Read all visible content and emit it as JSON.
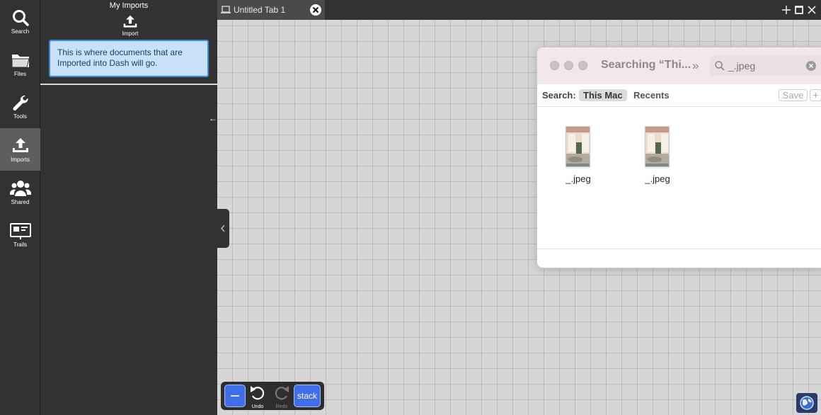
{
  "rail": {
    "items": [
      {
        "label": "Search",
        "icon": "search-icon"
      },
      {
        "label": "Files",
        "icon": "folder-icon"
      },
      {
        "label": "Tools",
        "icon": "wrench-icon"
      },
      {
        "label": "Imports",
        "icon": "upload-icon",
        "active": true
      },
      {
        "label": "Shared",
        "icon": "users-icon"
      },
      {
        "label": "Trails",
        "icon": "presentation-icon"
      }
    ]
  },
  "panel": {
    "title": "My Imports",
    "import_label": "Import",
    "info_text": "This is where documents that are Imported into Dash will go."
  },
  "tabs": {
    "active_title": "Untitled Tab 1"
  },
  "finder": {
    "title": "Searching “Thi...",
    "search_value": "_.jpeg",
    "scope_label": "Search:",
    "scope_this_mac": "This Mac",
    "scope_recents": "Recents",
    "save_label": "Save",
    "plus_label": "+",
    "files": [
      {
        "name": "_.jpeg"
      },
      {
        "name": "_.jpeg"
      }
    ]
  },
  "toolbar": {
    "undo_label": "Undo",
    "redo_label": "Redo",
    "stack_label": "stack"
  },
  "colors": {
    "accent_blue": "#3f6ee8",
    "dark_bg": "#323232",
    "info_box_bg": "#c8e1f8"
  }
}
